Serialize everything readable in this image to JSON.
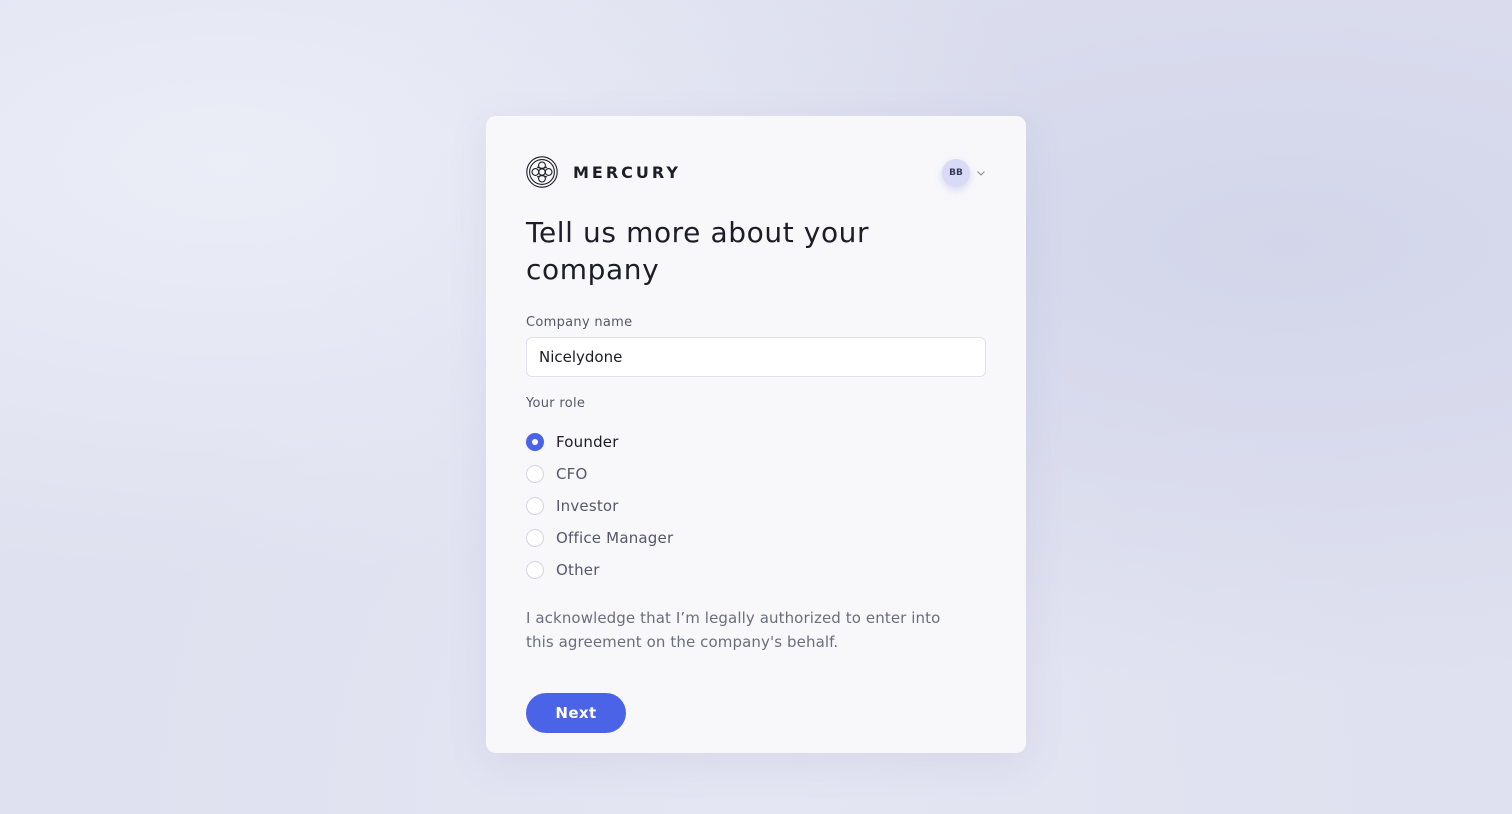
{
  "brand": {
    "name": "MERCURY",
    "logo_icon": "mercury-logo-icon"
  },
  "account": {
    "initials": "BB",
    "menu_icon": "chevron-down-icon"
  },
  "page": {
    "title": "Tell us more about your company"
  },
  "company_name": {
    "label": "Company name",
    "value": "Nicelydone"
  },
  "role": {
    "label": "Your role",
    "options": [
      {
        "label": "Founder",
        "selected": true
      },
      {
        "label": "CFO",
        "selected": false
      },
      {
        "label": "Investor",
        "selected": false
      },
      {
        "label": "Office Manager",
        "selected": false
      },
      {
        "label": "Other",
        "selected": false
      }
    ]
  },
  "acknowledgement": "I acknowledge that I’m legally authorized to enter into this agreement on the company's behalf.",
  "actions": {
    "next_label": "Next"
  },
  "colors": {
    "accent": "#4b63e6",
    "avatar_bg": "#d9daf6",
    "card_bg": "#f8f8fb",
    "text_primary": "#1c1d26",
    "text_secondary": "#6b6d7e"
  }
}
